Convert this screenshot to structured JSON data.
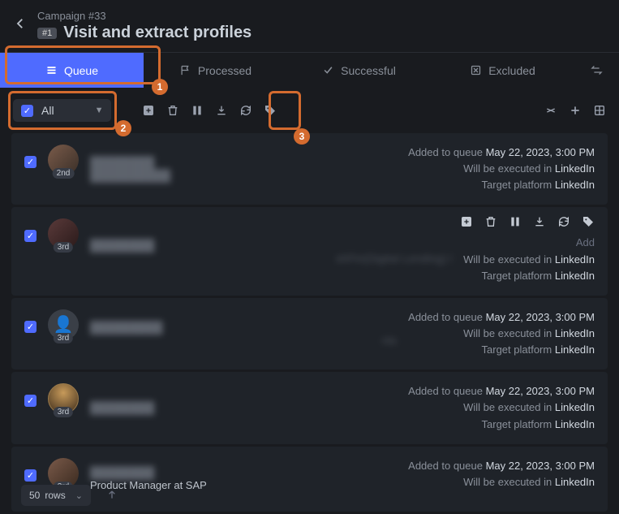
{
  "header": {
    "campaign_label": "Campaign #33",
    "badge": "#1",
    "title": "Visit and extract profiles"
  },
  "tabs": {
    "queue": "Queue",
    "processed": "Processed",
    "successful": "Successful",
    "excluded": "Excluded"
  },
  "toolbar": {
    "all_label": "All"
  },
  "annotations": {
    "step1": "1",
    "step2": "2",
    "step3": "3"
  },
  "meta": {
    "added_label": "Added to queue ",
    "added_date": "May 22, 2023, 3:00 PM",
    "exec_label": "Will be executed in ",
    "target_label": "Target platform ",
    "platform": "LinkedIn"
  },
  "cards": [
    {
      "degree": "2nd",
      "subtitle": ""
    },
    {
      "degree": "3rd",
      "subtitle_fragment": "shFin(Digital Lending) l",
      "added_prefix": "Add"
    },
    {
      "degree": "3rd",
      "subtitle_fragment": "nts"
    },
    {
      "degree": "3rd",
      "subtitle": ""
    },
    {
      "degree": "3rd",
      "visible_subtitle": "Product Manager at SAP"
    }
  ],
  "footer": {
    "rows_value": "50",
    "rows_label": "rows"
  }
}
